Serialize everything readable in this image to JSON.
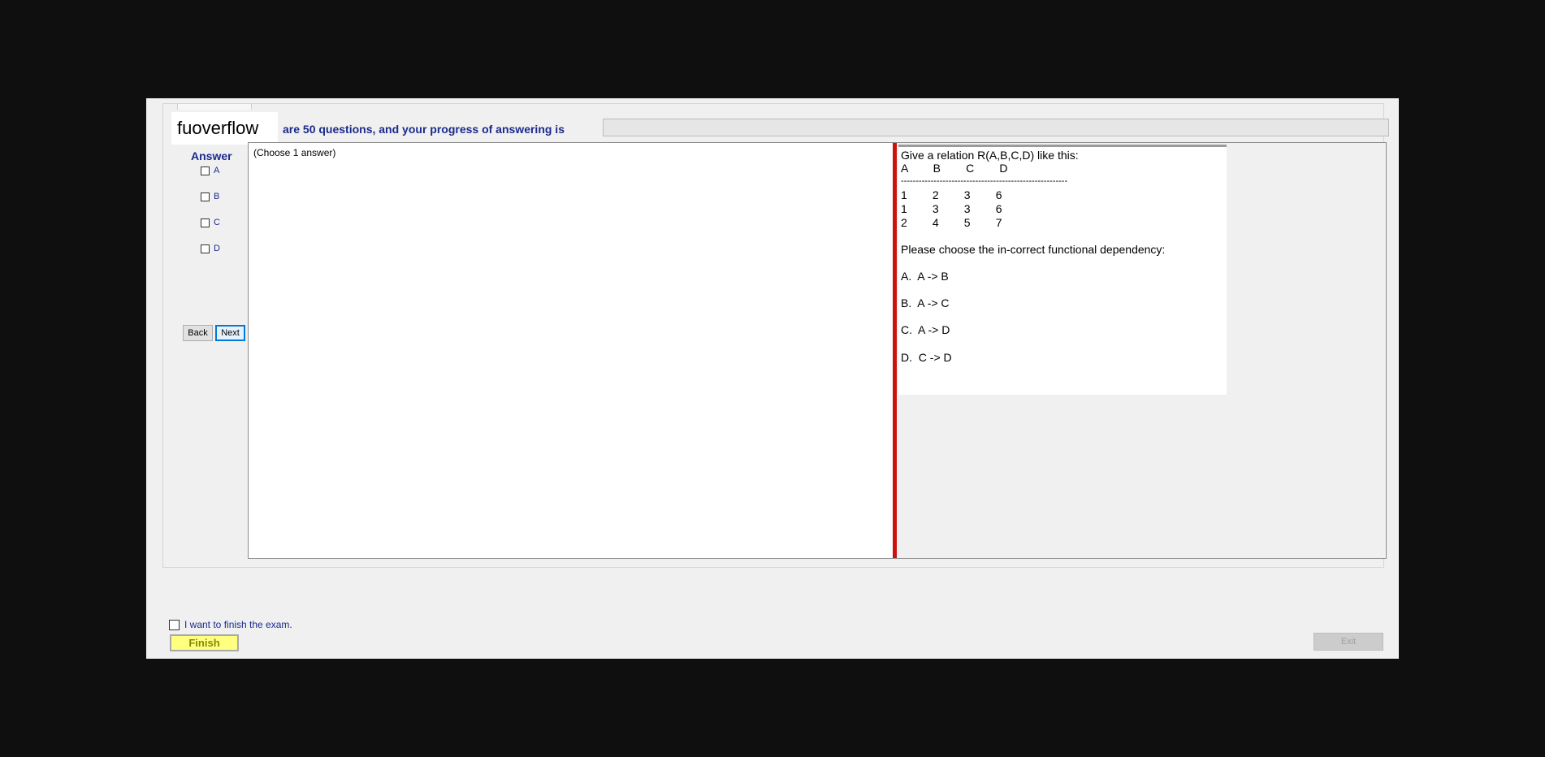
{
  "header": {
    "watermark": "fuoverflow",
    "info": "are 50 questions, and your progress of answering is"
  },
  "progress": {
    "value": 0
  },
  "answer": {
    "title": "Answer",
    "options": [
      "A",
      "B",
      "C",
      "D"
    ]
  },
  "nav": {
    "back": "Back",
    "next": "Next"
  },
  "choose_label": "(Choose 1 answer)",
  "question": {
    "intro": "Give a relation R(A,B,C,D) like this:",
    "header_row": "A        B        C        D",
    "separator": "--------------------------------------------------------",
    "rows": [
      "1        2        3        6",
      "1        3        3        6",
      "2        4        5        7"
    ],
    "prompt": "Please choose the in-correct functional dependency:",
    "choices": [
      "A.  A -> B",
      "B.  A -> C",
      "C.  A -> D",
      "D.  C -> D"
    ]
  },
  "footer": {
    "finish_check_label": "I want to finish the exam.",
    "finish_button": "Finish",
    "exit_button": "Exit"
  }
}
